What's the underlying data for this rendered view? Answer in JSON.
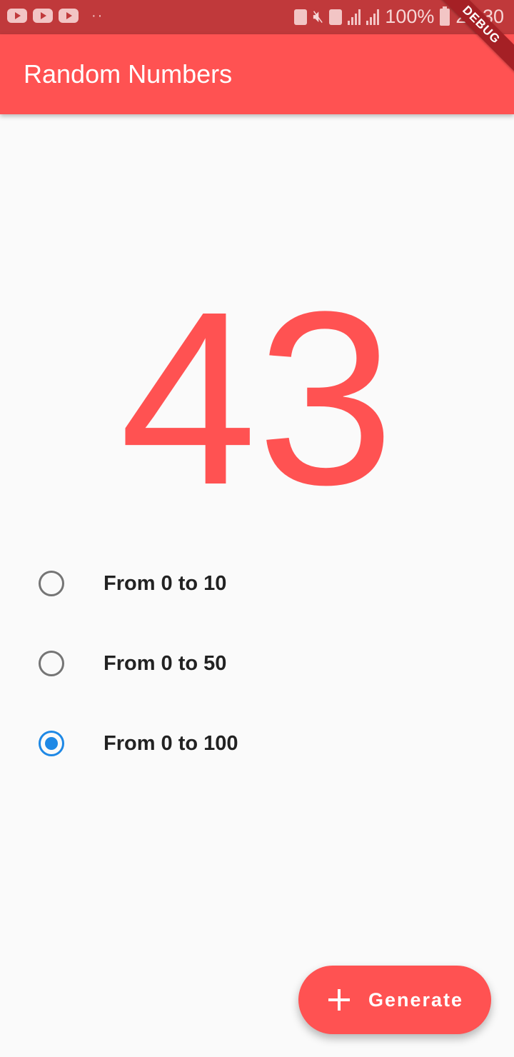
{
  "status_bar": {
    "battery_percent": "100%",
    "time": "22:30",
    "icons": [
      "youtube-icon",
      "youtube-icon",
      "youtube-icon",
      "more-dots-icon",
      "mute-icon",
      "signal-icon",
      "battery-icon"
    ],
    "dots": "··"
  },
  "app_bar": {
    "title": "Random Numbers",
    "debug_banner": "DEBUG"
  },
  "main": {
    "number": "43"
  },
  "options": [
    {
      "label": "From 0 to 10",
      "selected": false
    },
    {
      "label": "From 0 to 50",
      "selected": false
    },
    {
      "label": "From 0 to 100",
      "selected": true
    }
  ],
  "fab": {
    "label": "Generate",
    "icon": "plus-icon"
  },
  "colors": {
    "primary": "#ff5252",
    "status_bar": "#c0393b",
    "radio_selected": "#1e88e5",
    "radio_unselected": "#757575"
  }
}
